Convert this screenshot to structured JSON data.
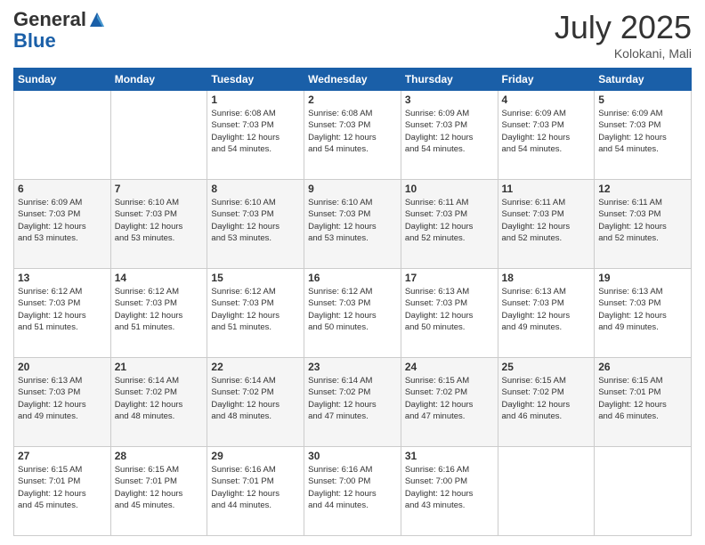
{
  "header": {
    "logo_general": "General",
    "logo_blue": "Blue",
    "month": "July 2025",
    "location": "Kolokani, Mali"
  },
  "days_of_week": [
    "Sunday",
    "Monday",
    "Tuesday",
    "Wednesday",
    "Thursday",
    "Friday",
    "Saturday"
  ],
  "weeks": [
    [
      {
        "day": "",
        "info": ""
      },
      {
        "day": "",
        "info": ""
      },
      {
        "day": "1",
        "info": "Sunrise: 6:08 AM\nSunset: 7:03 PM\nDaylight: 12 hours\nand 54 minutes."
      },
      {
        "day": "2",
        "info": "Sunrise: 6:08 AM\nSunset: 7:03 PM\nDaylight: 12 hours\nand 54 minutes."
      },
      {
        "day": "3",
        "info": "Sunrise: 6:09 AM\nSunset: 7:03 PM\nDaylight: 12 hours\nand 54 minutes."
      },
      {
        "day": "4",
        "info": "Sunrise: 6:09 AM\nSunset: 7:03 PM\nDaylight: 12 hours\nand 54 minutes."
      },
      {
        "day": "5",
        "info": "Sunrise: 6:09 AM\nSunset: 7:03 PM\nDaylight: 12 hours\nand 54 minutes."
      }
    ],
    [
      {
        "day": "6",
        "info": "Sunrise: 6:09 AM\nSunset: 7:03 PM\nDaylight: 12 hours\nand 53 minutes."
      },
      {
        "day": "7",
        "info": "Sunrise: 6:10 AM\nSunset: 7:03 PM\nDaylight: 12 hours\nand 53 minutes."
      },
      {
        "day": "8",
        "info": "Sunrise: 6:10 AM\nSunset: 7:03 PM\nDaylight: 12 hours\nand 53 minutes."
      },
      {
        "day": "9",
        "info": "Sunrise: 6:10 AM\nSunset: 7:03 PM\nDaylight: 12 hours\nand 53 minutes."
      },
      {
        "day": "10",
        "info": "Sunrise: 6:11 AM\nSunset: 7:03 PM\nDaylight: 12 hours\nand 52 minutes."
      },
      {
        "day": "11",
        "info": "Sunrise: 6:11 AM\nSunset: 7:03 PM\nDaylight: 12 hours\nand 52 minutes."
      },
      {
        "day": "12",
        "info": "Sunrise: 6:11 AM\nSunset: 7:03 PM\nDaylight: 12 hours\nand 52 minutes."
      }
    ],
    [
      {
        "day": "13",
        "info": "Sunrise: 6:12 AM\nSunset: 7:03 PM\nDaylight: 12 hours\nand 51 minutes."
      },
      {
        "day": "14",
        "info": "Sunrise: 6:12 AM\nSunset: 7:03 PM\nDaylight: 12 hours\nand 51 minutes."
      },
      {
        "day": "15",
        "info": "Sunrise: 6:12 AM\nSunset: 7:03 PM\nDaylight: 12 hours\nand 51 minutes."
      },
      {
        "day": "16",
        "info": "Sunrise: 6:12 AM\nSunset: 7:03 PM\nDaylight: 12 hours\nand 50 minutes."
      },
      {
        "day": "17",
        "info": "Sunrise: 6:13 AM\nSunset: 7:03 PM\nDaylight: 12 hours\nand 50 minutes."
      },
      {
        "day": "18",
        "info": "Sunrise: 6:13 AM\nSunset: 7:03 PM\nDaylight: 12 hours\nand 49 minutes."
      },
      {
        "day": "19",
        "info": "Sunrise: 6:13 AM\nSunset: 7:03 PM\nDaylight: 12 hours\nand 49 minutes."
      }
    ],
    [
      {
        "day": "20",
        "info": "Sunrise: 6:13 AM\nSunset: 7:03 PM\nDaylight: 12 hours\nand 49 minutes."
      },
      {
        "day": "21",
        "info": "Sunrise: 6:14 AM\nSunset: 7:02 PM\nDaylight: 12 hours\nand 48 minutes."
      },
      {
        "day": "22",
        "info": "Sunrise: 6:14 AM\nSunset: 7:02 PM\nDaylight: 12 hours\nand 48 minutes."
      },
      {
        "day": "23",
        "info": "Sunrise: 6:14 AM\nSunset: 7:02 PM\nDaylight: 12 hours\nand 47 minutes."
      },
      {
        "day": "24",
        "info": "Sunrise: 6:15 AM\nSunset: 7:02 PM\nDaylight: 12 hours\nand 47 minutes."
      },
      {
        "day": "25",
        "info": "Sunrise: 6:15 AM\nSunset: 7:02 PM\nDaylight: 12 hours\nand 46 minutes."
      },
      {
        "day": "26",
        "info": "Sunrise: 6:15 AM\nSunset: 7:01 PM\nDaylight: 12 hours\nand 46 minutes."
      }
    ],
    [
      {
        "day": "27",
        "info": "Sunrise: 6:15 AM\nSunset: 7:01 PM\nDaylight: 12 hours\nand 45 minutes."
      },
      {
        "day": "28",
        "info": "Sunrise: 6:15 AM\nSunset: 7:01 PM\nDaylight: 12 hours\nand 45 minutes."
      },
      {
        "day": "29",
        "info": "Sunrise: 6:16 AM\nSunset: 7:01 PM\nDaylight: 12 hours\nand 44 minutes."
      },
      {
        "day": "30",
        "info": "Sunrise: 6:16 AM\nSunset: 7:00 PM\nDaylight: 12 hours\nand 44 minutes."
      },
      {
        "day": "31",
        "info": "Sunrise: 6:16 AM\nSunset: 7:00 PM\nDaylight: 12 hours\nand 43 minutes."
      },
      {
        "day": "",
        "info": ""
      },
      {
        "day": "",
        "info": ""
      }
    ]
  ]
}
